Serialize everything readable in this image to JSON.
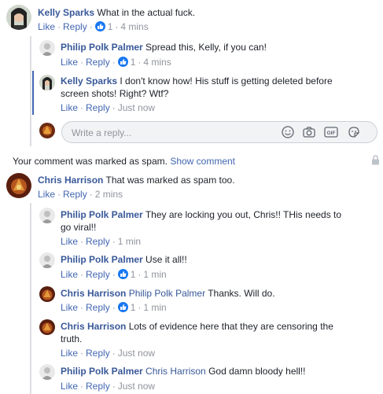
{
  "comments": [
    {
      "author": "Kelly Sparks",
      "text": "What in the actual fuck.",
      "like": "Like",
      "reply": "Reply",
      "reactions": "1",
      "time": "4 mins"
    },
    {
      "author": "Philip Polk Palmer",
      "text": "Spread this, Kelly, if you can!",
      "like": "Like",
      "reply": "Reply",
      "reactions": "1",
      "time": "4 mins"
    },
    {
      "author": "Kelly Sparks",
      "text_line1": "I don't know how! His stuff is getting deleted before",
      "text_line2": "screen shots! Right? Wtf?",
      "like": "Like",
      "reply": "Reply",
      "time": "Just now"
    },
    {
      "author": "Chris Harrison",
      "text": "That was marked as spam too.",
      "like": "Like",
      "reply": "Reply",
      "time": "2 mins"
    },
    {
      "author": "Philip Polk Palmer",
      "text_line1": "They are locking you out, Chris!! THis needs to",
      "text_line2": "go viral!!",
      "like": "Like",
      "reply": "Reply",
      "time": "1 min"
    },
    {
      "author": "Philip Polk Palmer",
      "text": "Use it all!!",
      "like": "Like",
      "reply": "Reply",
      "reactions": "1",
      "time": "1 min"
    },
    {
      "author": "Chris Harrison",
      "mention": "Philip Polk Palmer",
      "text": "Thanks. Will do.",
      "like": "Like",
      "reply": "Reply",
      "reactions": "1",
      "time": "1 min"
    },
    {
      "author": "Chris Harrison",
      "text_line1": "Lots of evidence here that they are censoring the",
      "text_line2": "truth.",
      "like": "Like",
      "reply": "Reply",
      "time": "Just now"
    },
    {
      "author": "Philip Polk Palmer",
      "mention": "Chris Harrison",
      "text": "God damn bloody hell!!",
      "like": "Like",
      "reply": "Reply",
      "time": "Just now"
    }
  ],
  "reply_box": {
    "placeholder": "Write a reply...",
    "gif_label": "GIF"
  },
  "spam_notice": {
    "text": "Your comment was marked as spam.",
    "link": "Show comment"
  },
  "icons": [
    "emoji-icon",
    "camera-icon",
    "gif-icon",
    "sticker-icon",
    "lock-icon",
    "like-reaction-icon"
  ],
  "colors": {
    "name": "#385898",
    "link": "#4267b2",
    "meta": "#90949c",
    "reaction": "#1877f2"
  }
}
